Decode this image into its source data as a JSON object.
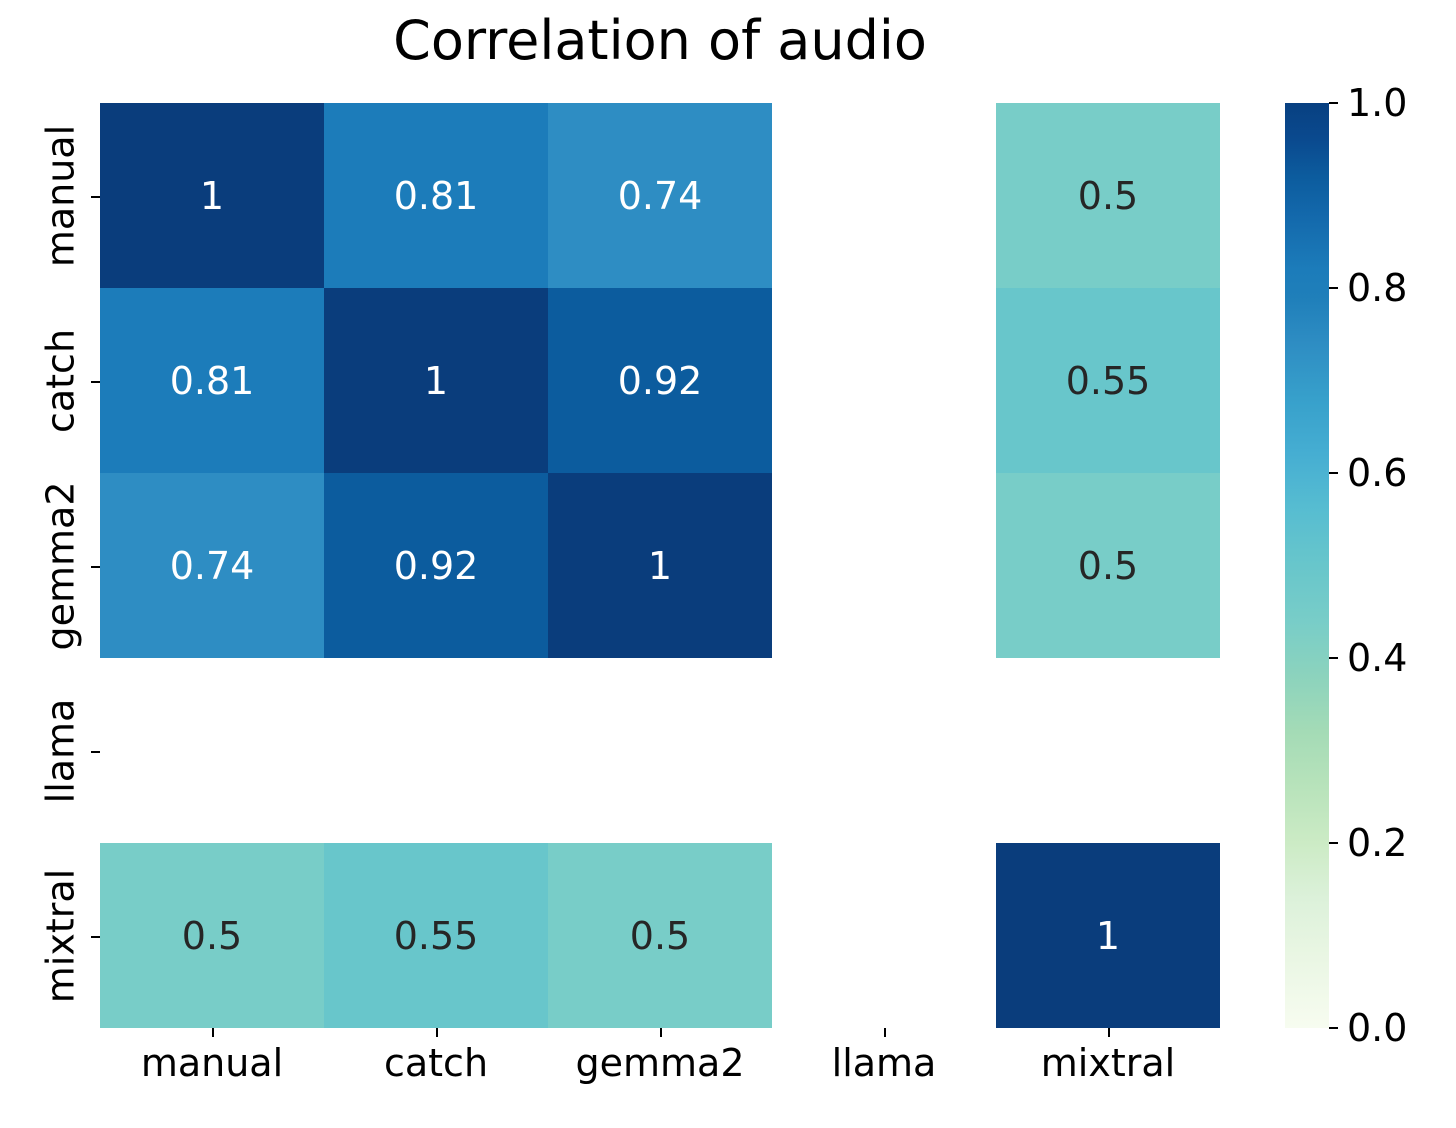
{
  "chart_data": {
    "type": "heatmap",
    "title": "Correlation of audio",
    "xlabel": "",
    "ylabel": "",
    "colormap": "GnBu",
    "colorbar": {
      "min": 0.0,
      "max": 1.0,
      "ticks": [
        "0.0",
        "0.2",
        "0.4",
        "0.6",
        "0.8",
        "1.0"
      ],
      "tick_values": [
        0.0,
        0.2,
        0.4,
        0.6,
        0.8,
        1.0
      ],
      "position": "right"
    },
    "x_categories": [
      "manual",
      "catch",
      "gemma2",
      "llama",
      "mixtral"
    ],
    "y_categories": [
      "manual",
      "catch",
      "gemma2",
      "llama",
      "mixtral"
    ],
    "matrix": [
      [
        1,
        0.81,
        0.74,
        null,
        0.5
      ],
      [
        0.81,
        1,
        0.92,
        null,
        0.55
      ],
      [
        0.74,
        0.92,
        1,
        null,
        0.5
      ],
      [
        null,
        null,
        null,
        null,
        null
      ],
      [
        0.5,
        0.55,
        0.5,
        null,
        1
      ]
    ],
    "cells": [
      {
        "row": 0,
        "col": 0,
        "label": "1",
        "value": 1,
        "color": "#0a3d7c",
        "text_color": "#ffffff"
      },
      {
        "row": 0,
        "col": 1,
        "label": "0.81",
        "value": 0.81,
        "color": "#1c7cba",
        "text_color": "#ffffff"
      },
      {
        "row": 0,
        "col": 2,
        "label": "0.74",
        "value": 0.74,
        "color": "#2e8dc3",
        "text_color": "#ffffff"
      },
      {
        "row": 0,
        "col": 3,
        "label": "",
        "value": null,
        "color": "none",
        "text_color": "#262626"
      },
      {
        "row": 0,
        "col": 4,
        "label": "0.5",
        "value": 0.5,
        "color": "#78cdc8",
        "text_color": "#262626"
      },
      {
        "row": 1,
        "col": 0,
        "label": "0.81",
        "value": 0.81,
        "color": "#1c7cba",
        "text_color": "#ffffff"
      },
      {
        "row": 1,
        "col": 1,
        "label": "1",
        "value": 1,
        "color": "#0a3d7c",
        "text_color": "#ffffff"
      },
      {
        "row": 1,
        "col": 2,
        "label": "0.92",
        "value": 0.92,
        "color": "#0c5c9e",
        "text_color": "#ffffff"
      },
      {
        "row": 1,
        "col": 3,
        "label": "",
        "value": null,
        "color": "none",
        "text_color": "#262626"
      },
      {
        "row": 1,
        "col": 4,
        "label": "0.55",
        "value": 0.55,
        "color": "#68c6cb",
        "text_color": "#262626"
      },
      {
        "row": 2,
        "col": 0,
        "label": "0.74",
        "value": 0.74,
        "color": "#2e8dc3",
        "text_color": "#ffffff"
      },
      {
        "row": 2,
        "col": 1,
        "label": "0.92",
        "value": 0.92,
        "color": "#0c5c9e",
        "text_color": "#ffffff"
      },
      {
        "row": 2,
        "col": 2,
        "label": "1",
        "value": 1,
        "color": "#0a3d7c",
        "text_color": "#ffffff"
      },
      {
        "row": 2,
        "col": 3,
        "label": "",
        "value": null,
        "color": "none",
        "text_color": "#262626"
      },
      {
        "row": 2,
        "col": 4,
        "label": "0.5",
        "value": 0.5,
        "color": "#78cdc8",
        "text_color": "#262626"
      },
      {
        "row": 3,
        "col": 0,
        "label": "",
        "value": null,
        "color": "none",
        "text_color": "#262626"
      },
      {
        "row": 3,
        "col": 1,
        "label": "",
        "value": null,
        "color": "none",
        "text_color": "#262626"
      },
      {
        "row": 3,
        "col": 2,
        "label": "",
        "value": null,
        "color": "none",
        "text_color": "#262626"
      },
      {
        "row": 3,
        "col": 3,
        "label": "",
        "value": null,
        "color": "none",
        "text_color": "#262626"
      },
      {
        "row": 3,
        "col": 4,
        "label": "",
        "value": null,
        "color": "none",
        "text_color": "#262626"
      },
      {
        "row": 4,
        "col": 0,
        "label": "0.5",
        "value": 0.5,
        "color": "#78cdc8",
        "text_color": "#262626"
      },
      {
        "row": 4,
        "col": 1,
        "label": "0.55",
        "value": 0.55,
        "color": "#68c6cb",
        "text_color": "#262626"
      },
      {
        "row": 4,
        "col": 2,
        "label": "0.5",
        "value": 0.5,
        "color": "#78cdc8",
        "text_color": "#262626"
      },
      {
        "row": 4,
        "col": 3,
        "label": "",
        "value": null,
        "color": "none",
        "text_color": "#262626"
      },
      {
        "row": 4,
        "col": 4,
        "label": "1",
        "value": 1,
        "color": "#0a3d7c",
        "text_color": "#ffffff"
      }
    ]
  }
}
